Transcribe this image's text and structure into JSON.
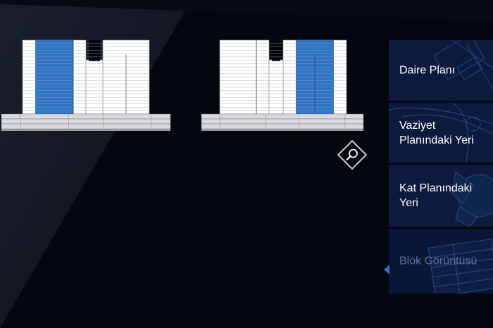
{
  "menu": {
    "items": [
      {
        "label": "Daire Planı",
        "active": false,
        "deco": "floor-plan"
      },
      {
        "label": "Vaziyet Planındaki Yeri",
        "active": false,
        "deco": "site-plan"
      },
      {
        "label": "Kat Planındaki Yeri",
        "active": false,
        "deco": "floor-layout"
      },
      {
        "label": "Blok Görüntüsü",
        "active": true,
        "deco": "block-view"
      }
    ]
  },
  "zoom": {
    "icon": "magnifier-icon"
  },
  "elevations": [
    {
      "highlight": "left"
    },
    {
      "highlight": "right"
    }
  ],
  "colors": {
    "background": "#05070e",
    "panel": "#0c1b3d",
    "highlight": "#2f74c6",
    "active_label": "#5b6f9e",
    "active_arrow": "#3e6ad0"
  }
}
